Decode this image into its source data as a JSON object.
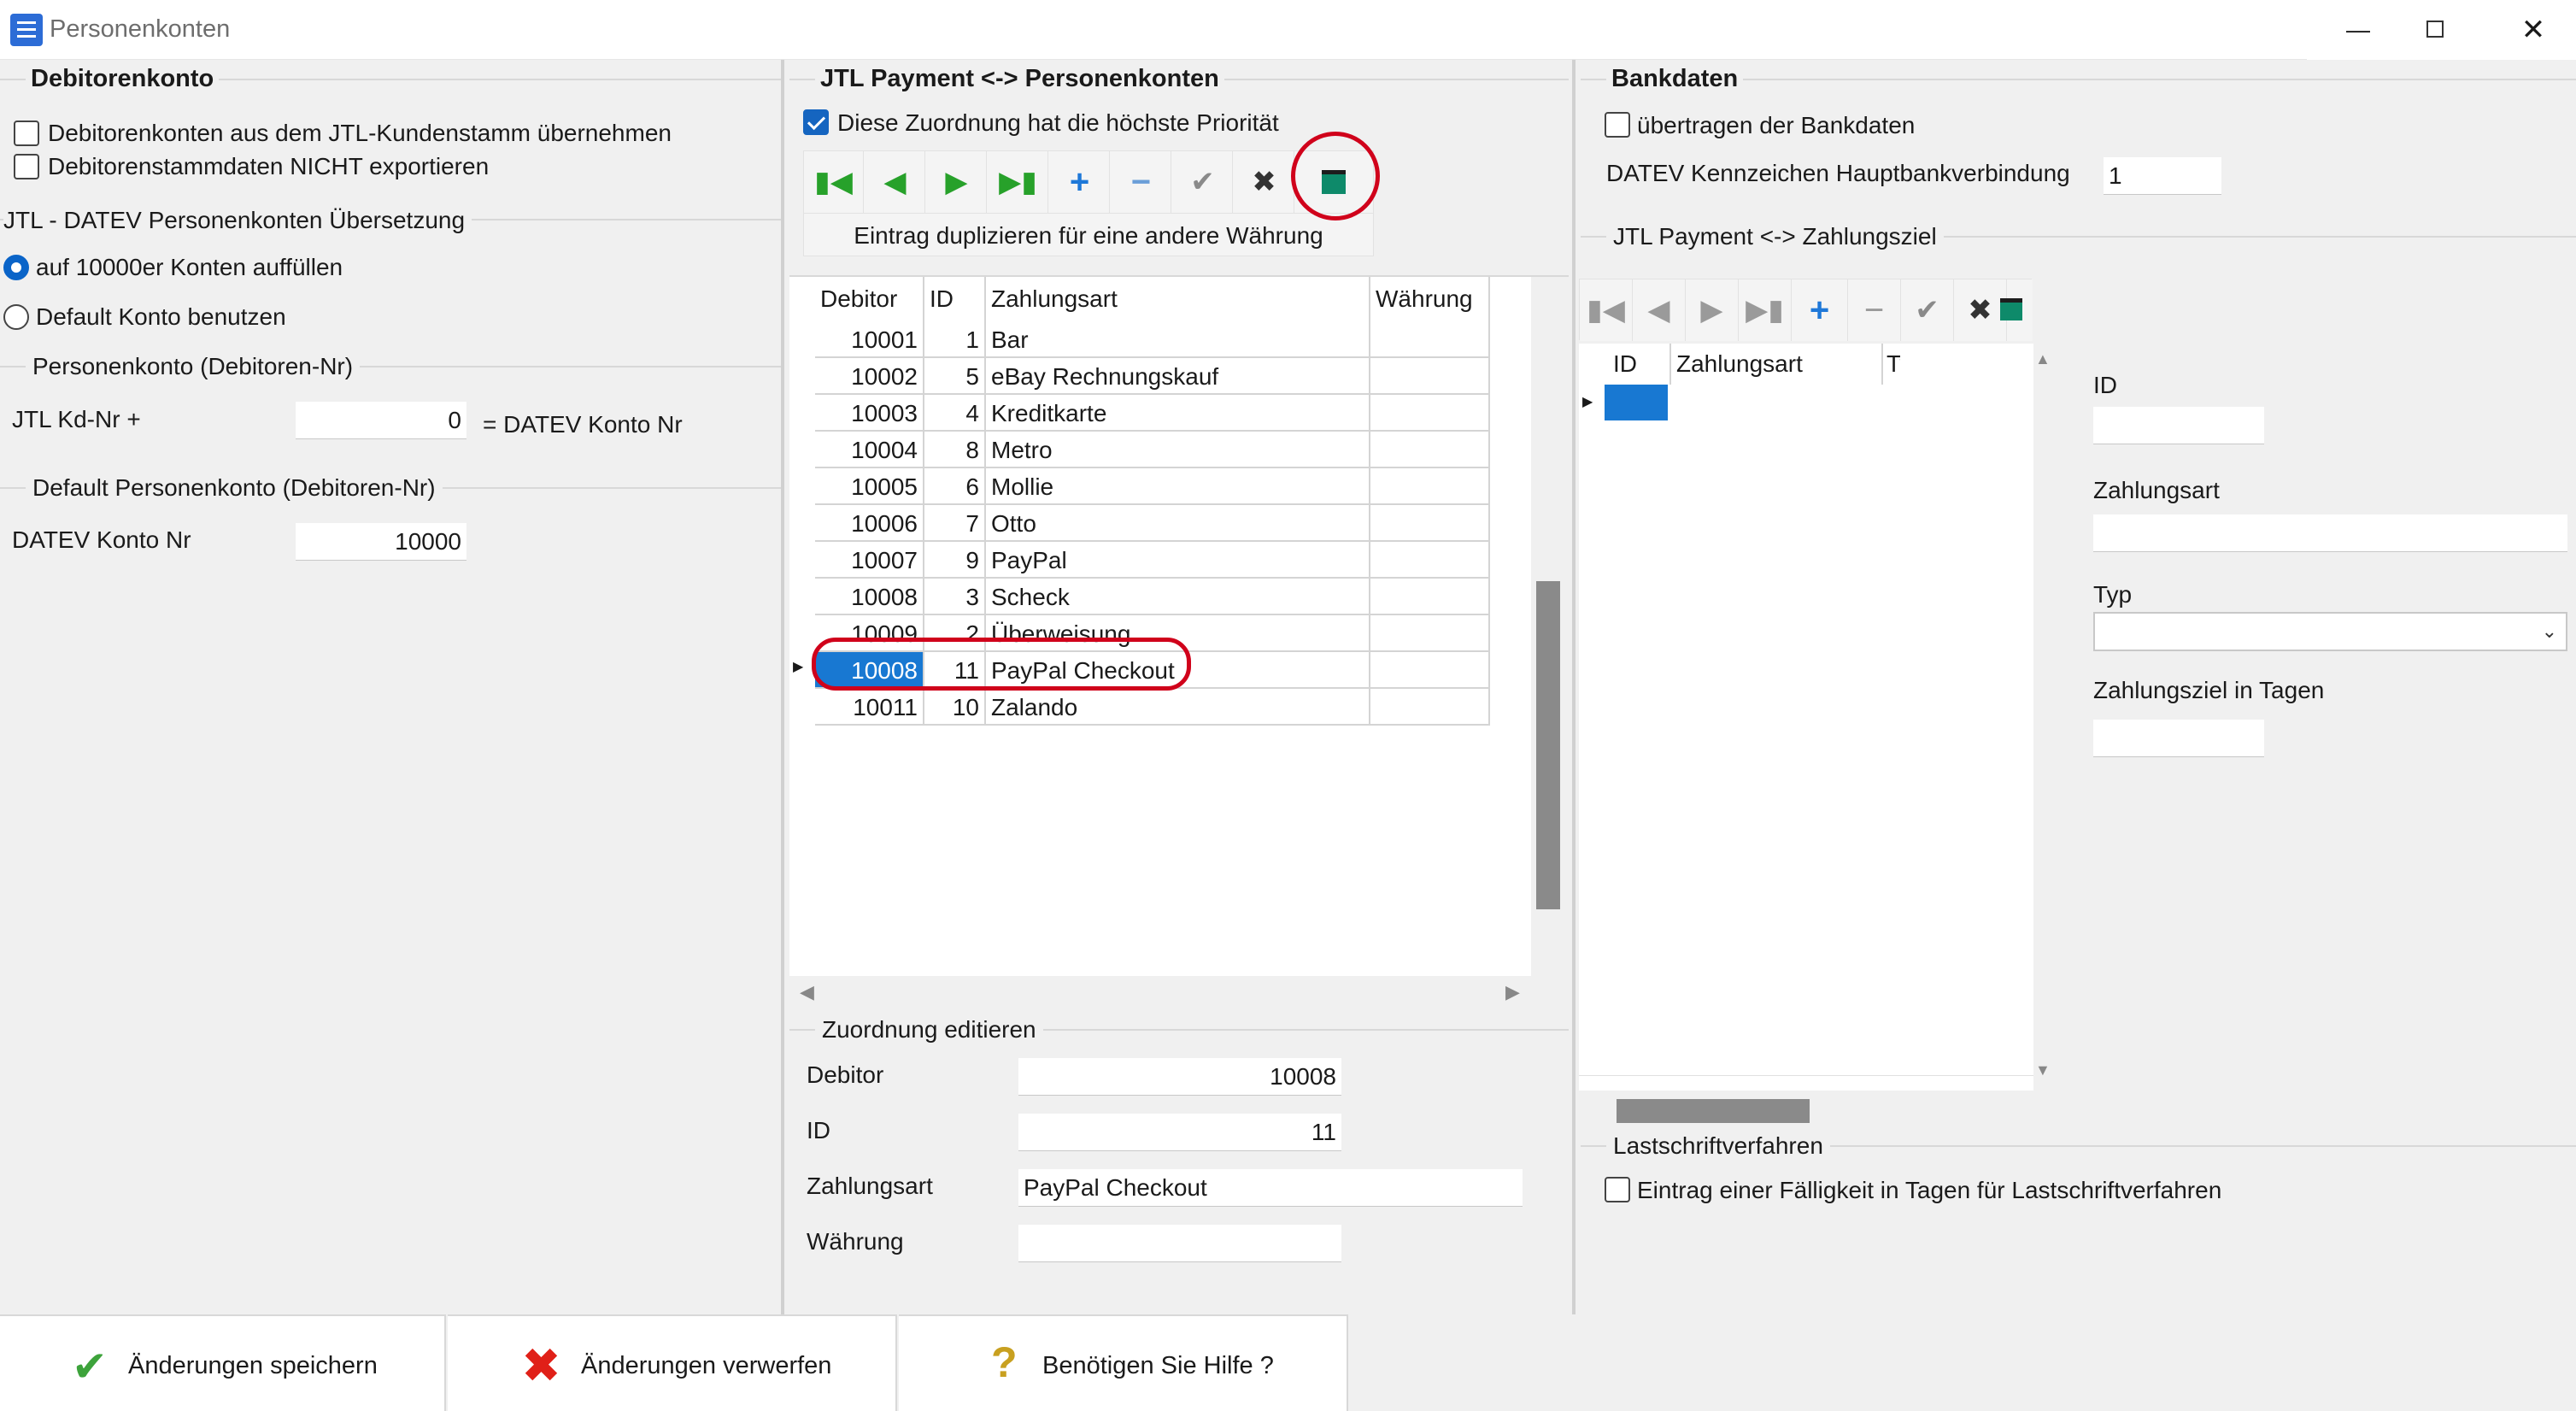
{
  "window": {
    "title": "Personenkonten"
  },
  "left": {
    "debitor_title": "Debitorenkonto",
    "cb1": "Debitorenkonten aus dem JTL-Kundenstamm übernehmen",
    "cb2": "Debitorenstammdaten NICHT exportieren",
    "uebersetzung_title": "JTL - DATEV Personenkonten Übersetzung",
    "radio1": "auf 10000er Konten auffüllen",
    "radio2": "Default Konto benutzen",
    "personenkonto_title": "Personenkonto (Debitoren-Nr)",
    "kdnr_label": "JTL Kd-Nr +",
    "kdnr_value": "0",
    "datev_suffix": "= DATEV Konto Nr",
    "default_title": "Default Personenkonto (Debitoren-Nr)",
    "datev_konto_label": "DATEV Konto Nr",
    "datev_konto_value": "10000"
  },
  "middle": {
    "title": "JTL Payment <-> Personenkonten",
    "priority_label": "Diese Zuordnung hat die höchste Priorität",
    "dup_button": "Eintrag duplizieren für eine andere Währung",
    "columns": [
      "Debitor",
      "ID",
      "Zahlungsart",
      "Währung"
    ],
    "rows": [
      {
        "debitor": "10001",
        "id": "1",
        "zahlungsart": "Bar",
        "waehrung": ""
      },
      {
        "debitor": "10002",
        "id": "5",
        "zahlungsart": "eBay Rechnungskauf",
        "waehrung": ""
      },
      {
        "debitor": "10003",
        "id": "4",
        "zahlungsart": "Kreditkarte",
        "waehrung": ""
      },
      {
        "debitor": "10004",
        "id": "8",
        "zahlungsart": "Metro",
        "waehrung": ""
      },
      {
        "debitor": "10005",
        "id": "6",
        "zahlungsart": "Mollie",
        "waehrung": ""
      },
      {
        "debitor": "10006",
        "id": "7",
        "zahlungsart": "Otto",
        "waehrung": ""
      },
      {
        "debitor": "10007",
        "id": "9",
        "zahlungsart": "PayPal",
        "waehrung": ""
      },
      {
        "debitor": "10008",
        "id": "3",
        "zahlungsart": "Scheck",
        "waehrung": ""
      },
      {
        "debitor": "10009",
        "id": "2",
        "zahlungsart": "Überweisung",
        "waehrung": ""
      },
      {
        "debitor": "10008",
        "id": "11",
        "zahlungsart": "PayPal Checkout",
        "waehrung": ""
      },
      {
        "debitor": "10011",
        "id": "10",
        "zahlungsart": "Zalando",
        "waehrung": ""
      }
    ],
    "edit_title": "Zuordnung editieren",
    "edit_debitor_label": "Debitor",
    "edit_debitor_value": "10008",
    "edit_id_label": "ID",
    "edit_id_value": "11",
    "edit_zahlungsart_label": "Zahlungsart",
    "edit_zahlungsart_value": "PayPal Checkout",
    "edit_waehrung_label": "Währung",
    "edit_waehrung_value": ""
  },
  "right": {
    "bank_title": "Bankdaten",
    "bank_cb": "übertragen der Bankdaten",
    "hauptbank_label": "DATEV Kennzeichen Hauptbankverbindung",
    "hauptbank_value": "1",
    "zahlungsziel_title": "JTL Payment <-> Zahlungsziel",
    "columns": [
      "ID",
      "Zahlungsart",
      "Ty"
    ],
    "id_label": "ID",
    "zahlungsart_label": "Zahlungsart",
    "typ_label": "Typ",
    "ziel_label": "Zahlungsziel in Tagen",
    "lastschrift_title": "Lastschriftverfahren",
    "lastschrift_cb": "Eintrag einer Fälligkeit in Tagen für Lastschriftverfahren"
  },
  "bottom": {
    "save": "Änderungen speichern",
    "discard": "Änderungen verwerfen",
    "help": "Benötigen Sie Hilfe ?"
  },
  "colors": {
    "accent": "#0a64c8",
    "selection": "#1878d2",
    "highlight": "#d0021b"
  }
}
